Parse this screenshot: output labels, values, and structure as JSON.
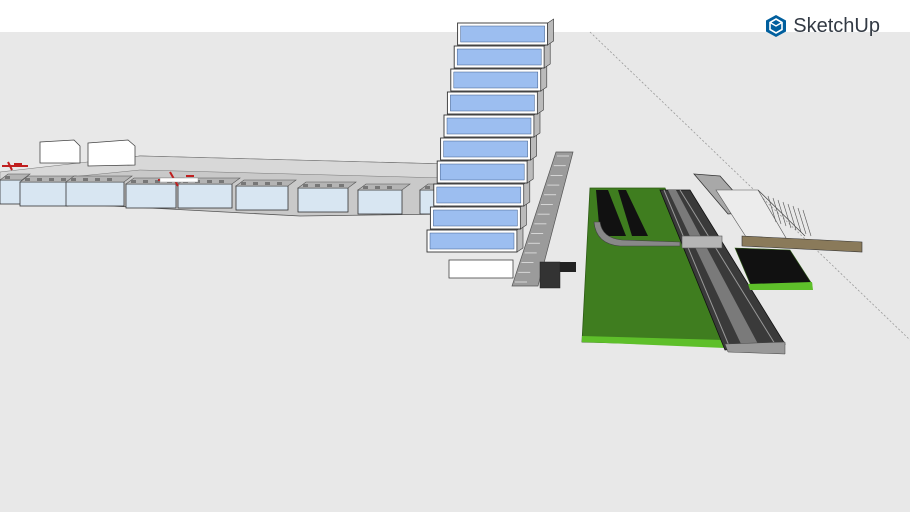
{
  "app": {
    "brand_name": "SketchUp",
    "brand_color": "#005f9e",
    "logo_icon": "sketchup-logo-icon"
  },
  "viewport": {
    "sky_color": "#ffffff",
    "ground_color": "#e8e8e8"
  },
  "scene": {
    "colors": {
      "glass": "#9cbef0",
      "slab": "#ffffff",
      "outline": "#333333",
      "platform": "#c8c8c8",
      "grass": "#3f7d1f",
      "grass_edge": "#5ebf2a",
      "track": "#222222",
      "aircraft_accent": "#d41e1e"
    }
  }
}
